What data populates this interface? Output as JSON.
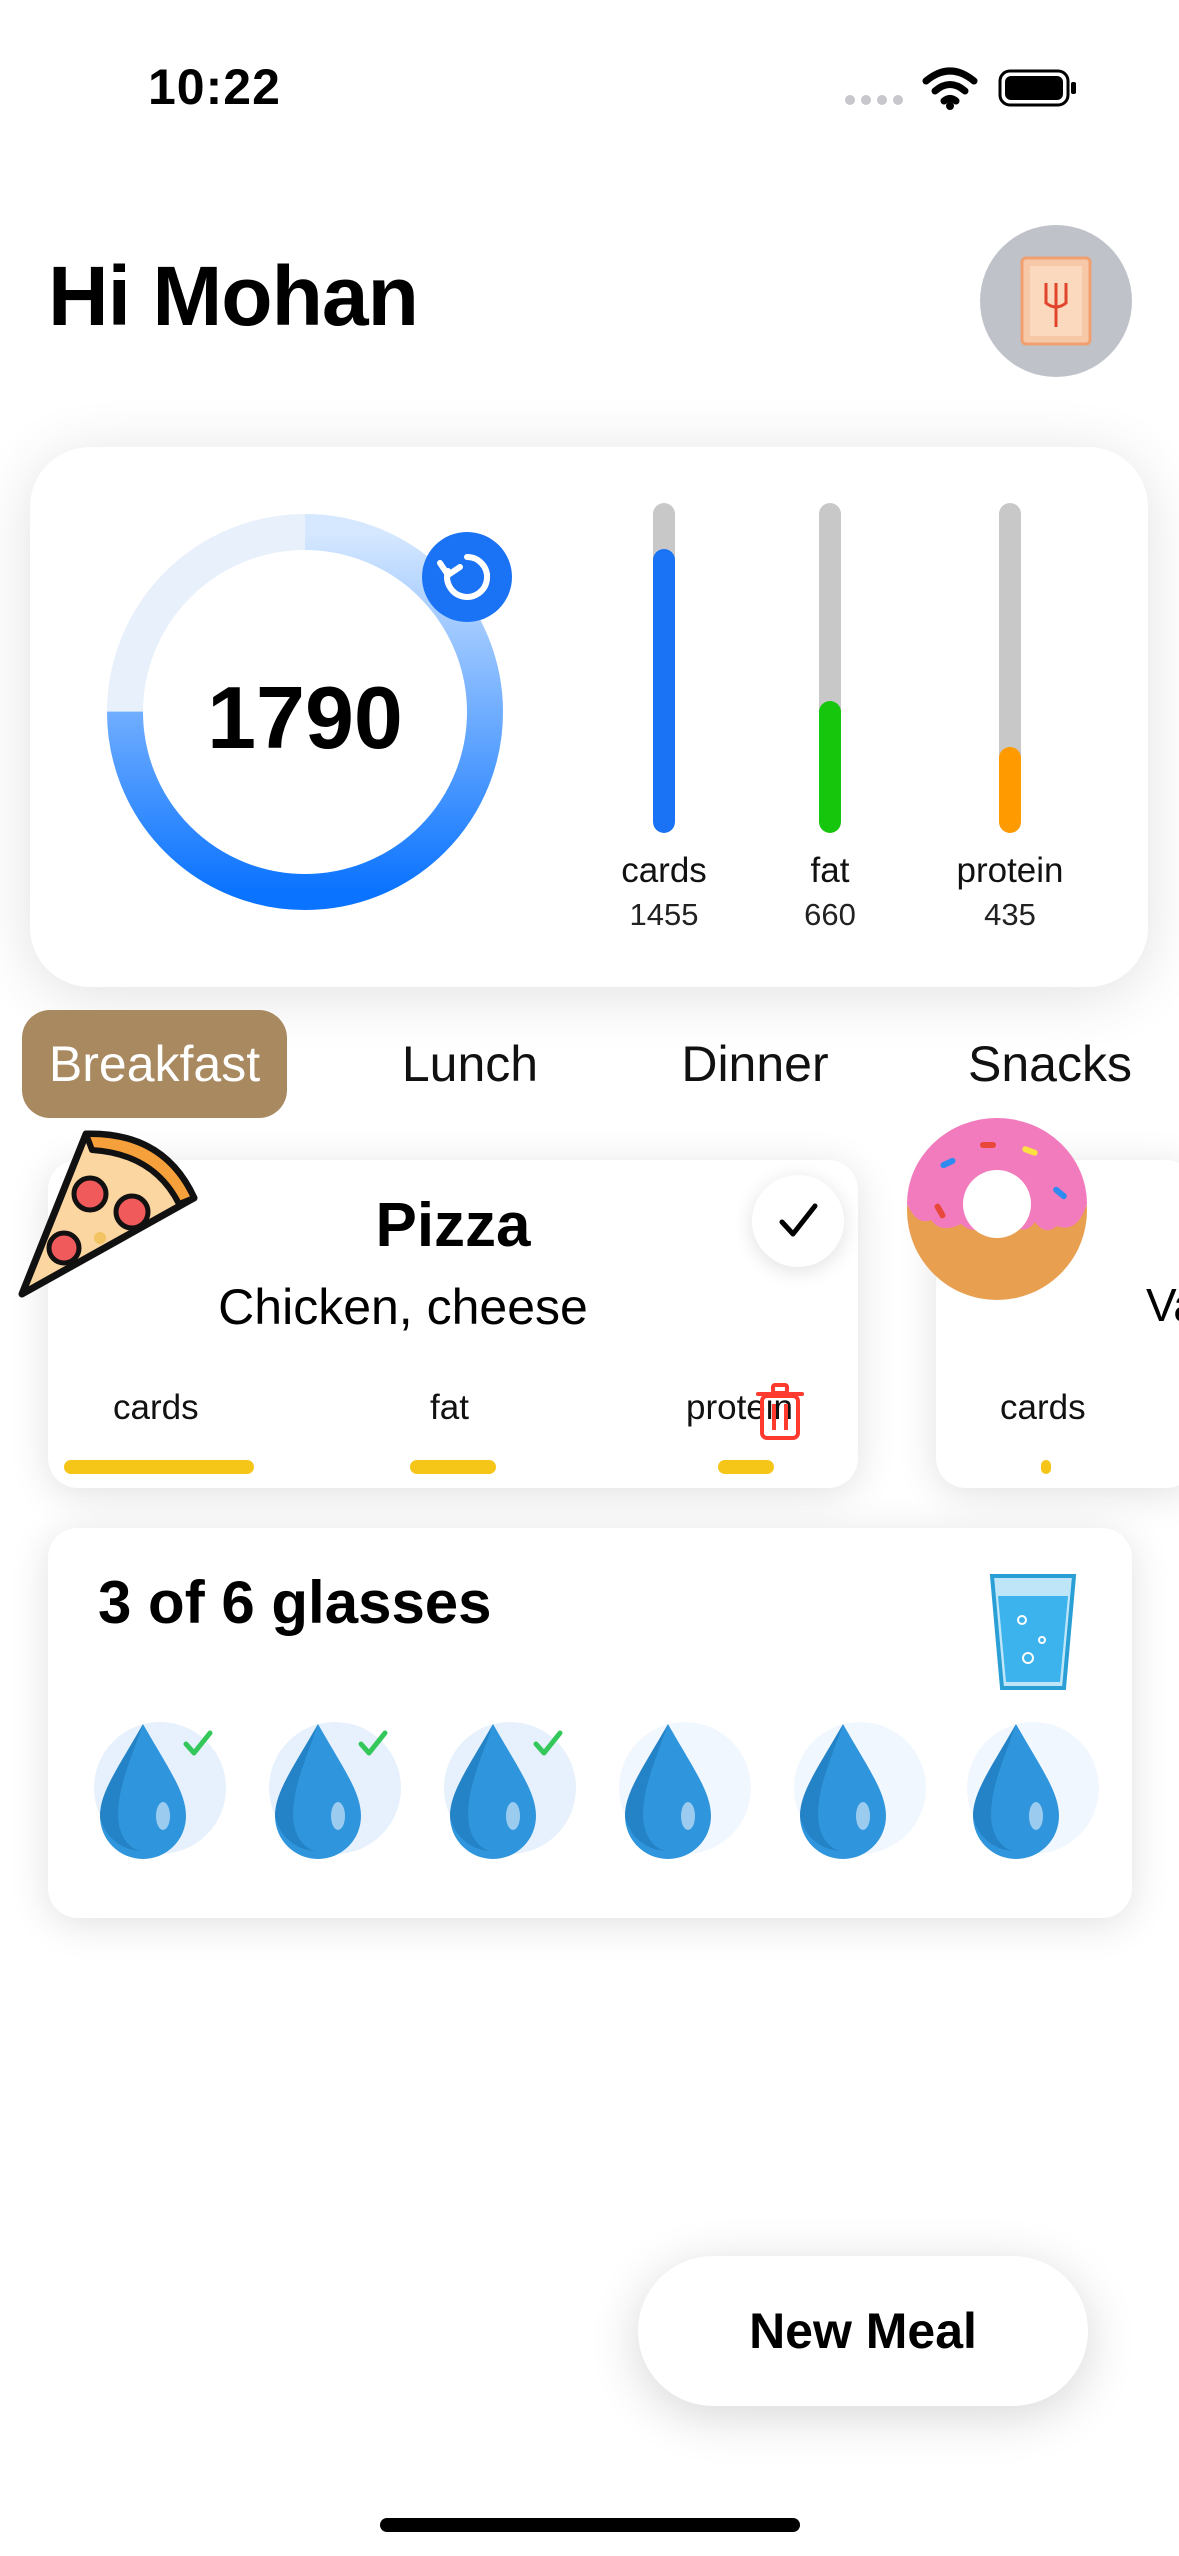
{
  "status_bar": {
    "time": "10:22"
  },
  "header": {
    "greeting": "Hi Mohan"
  },
  "summary": {
    "calories": "1790",
    "ring_progress": 0.75,
    "macros": [
      {
        "label": "cards",
        "value": "1455",
        "progress": 0.86,
        "color": "#1a73f5"
      },
      {
        "label": "fat",
        "value": "660",
        "progress": 0.4,
        "color": "#16c60c"
      },
      {
        "label": "protein",
        "value": "435",
        "progress": 0.26,
        "color": "#ff9a00"
      }
    ]
  },
  "tabs": [
    "Breakfast",
    "Lunch",
    "Dinner",
    "Snacks"
  ],
  "meals": [
    {
      "title": "Pizza",
      "description": "Chicken, cheese",
      "macro_labels": [
        "cards",
        "fat",
        "protein"
      ],
      "icon": "pizza-icon"
    },
    {
      "title": "Vani",
      "macro_labels": [
        "cards"
      ],
      "icon": "donut-icon"
    }
  ],
  "water": {
    "title": "3 of 6 glasses",
    "glasses_total": 6,
    "glasses_done": 3
  },
  "actions": {
    "new_meal": "New Meal"
  },
  "colors": {
    "accent": "#1a73f5",
    "tab_active": "#a88960",
    "macro_line": "#f5c518",
    "delete": "#ff3b30",
    "check": "#34c759"
  }
}
